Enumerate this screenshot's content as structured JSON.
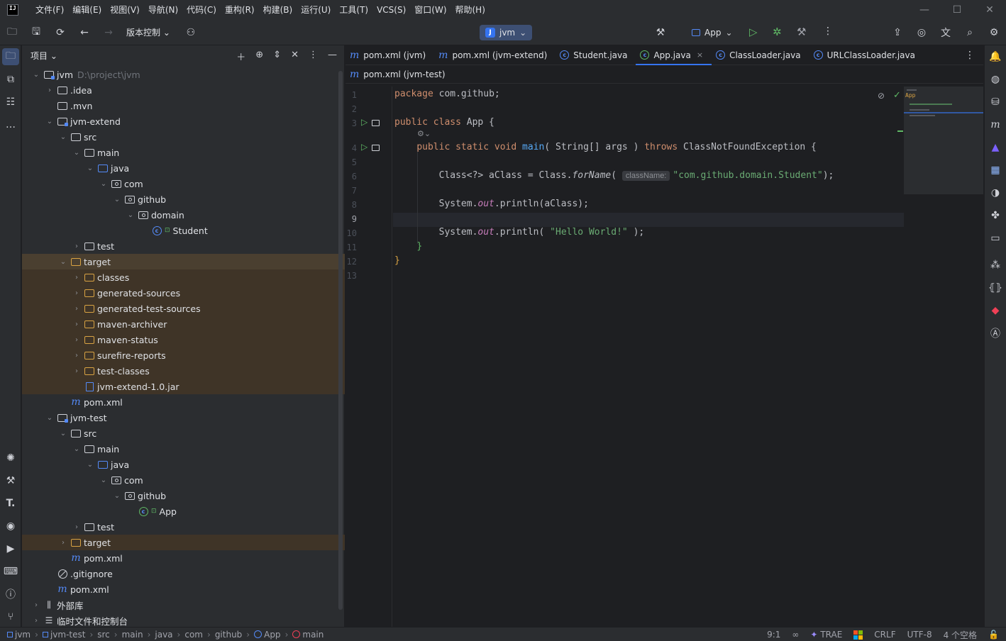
{
  "menu": [
    "文件(F)",
    "编辑(E)",
    "视图(V)",
    "导航(N)",
    "代码(C)",
    "重构(R)",
    "构建(B)",
    "运行(U)",
    "工具(T)",
    "VCS(S)",
    "窗口(W)",
    "帮助(H)"
  ],
  "toolbar": {
    "vcs_label": "版本控制",
    "project_name": "jvm",
    "project_badge": "J",
    "run_config": "App"
  },
  "project_panel": {
    "title": "项目",
    "tree": [
      {
        "label": "jvm",
        "extra": "D:\\project\\jvm",
        "icon": "module",
        "depth": 0,
        "expanded": true
      },
      {
        "label": ".idea",
        "icon": "folder",
        "depth": 1,
        "expanded": false
      },
      {
        "label": ".mvn",
        "icon": "folder",
        "depth": 1,
        "leaf": true
      },
      {
        "label": "jvm-extend",
        "icon": "module",
        "depth": 1,
        "expanded": true
      },
      {
        "label": "src",
        "icon": "folder",
        "depth": 2,
        "expanded": true
      },
      {
        "label": "main",
        "icon": "folder",
        "depth": 3,
        "expanded": true
      },
      {
        "label": "java",
        "icon": "folder-blue",
        "depth": 4,
        "expanded": true
      },
      {
        "label": "com",
        "icon": "package",
        "depth": 5,
        "expanded": true
      },
      {
        "label": "github",
        "icon": "package",
        "depth": 6,
        "expanded": true
      },
      {
        "label": "domain",
        "icon": "package",
        "depth": 7,
        "expanded": true
      },
      {
        "label": "Student",
        "icon": "class",
        "depth": 8,
        "leaf": true
      },
      {
        "label": "test",
        "icon": "folder",
        "depth": 3,
        "expanded": false
      },
      {
        "label": "target",
        "icon": "folder-orange",
        "depth": 2,
        "expanded": true,
        "style": "selected"
      },
      {
        "label": "classes",
        "icon": "folder-orange",
        "depth": 3,
        "expanded": false,
        "style": "excluded"
      },
      {
        "label": "generated-sources",
        "icon": "folder-orange",
        "depth": 3,
        "expanded": false,
        "style": "excluded"
      },
      {
        "label": "generated-test-sources",
        "icon": "folder-orange",
        "depth": 3,
        "expanded": false,
        "style": "excluded"
      },
      {
        "label": "maven-archiver",
        "icon": "folder-orange",
        "depth": 3,
        "expanded": false,
        "style": "excluded"
      },
      {
        "label": "maven-status",
        "icon": "folder-orange",
        "depth": 3,
        "expanded": false,
        "style": "excluded"
      },
      {
        "label": "surefire-reports",
        "icon": "folder-orange",
        "depth": 3,
        "expanded": false,
        "style": "excluded"
      },
      {
        "label": "test-classes",
        "icon": "folder-orange",
        "depth": 3,
        "expanded": false,
        "style": "excluded"
      },
      {
        "label": "jvm-extend-1.0.jar",
        "icon": "jar",
        "depth": 3,
        "leaf": true,
        "style": "excluded"
      },
      {
        "label": "pom.xml",
        "icon": "maven",
        "depth": 2,
        "leaf": true
      },
      {
        "label": "jvm-test",
        "icon": "module",
        "depth": 1,
        "expanded": true
      },
      {
        "label": "src",
        "icon": "folder",
        "depth": 2,
        "expanded": true
      },
      {
        "label": "main",
        "icon": "folder",
        "depth": 3,
        "expanded": true
      },
      {
        "label": "java",
        "icon": "folder-blue",
        "depth": 4,
        "expanded": true
      },
      {
        "label": "com",
        "icon": "package",
        "depth": 5,
        "expanded": true
      },
      {
        "label": "github",
        "icon": "package",
        "depth": 6,
        "expanded": true
      },
      {
        "label": "App",
        "icon": "class-run",
        "depth": 7,
        "leaf": true
      },
      {
        "label": "test",
        "icon": "folder",
        "depth": 3,
        "expanded": false
      },
      {
        "label": "target",
        "icon": "folder-orange",
        "depth": 2,
        "expanded": false,
        "style": "excluded"
      },
      {
        "label": "pom.xml",
        "icon": "maven",
        "depth": 2,
        "leaf": true
      },
      {
        "label": ".gitignore",
        "icon": "gitignore",
        "depth": 1,
        "leaf": true
      },
      {
        "label": "pom.xml",
        "icon": "maven",
        "depth": 1,
        "leaf": true
      },
      {
        "label": "外部库",
        "icon": "library",
        "depth": 0,
        "expanded": false
      },
      {
        "label": "临时文件和控制台",
        "icon": "scratch",
        "depth": 0,
        "expanded": false
      }
    ]
  },
  "editor": {
    "tabs": [
      {
        "label": "pom.xml (jvm)",
        "icon": "maven"
      },
      {
        "label": "pom.xml (jvm-extend)",
        "icon": "maven"
      },
      {
        "label": "Student.java",
        "icon": "class"
      },
      {
        "label": "App.java",
        "icon": "class-run",
        "active": true
      },
      {
        "label": "ClassLoader.java",
        "icon": "class"
      },
      {
        "label": "URLClassLoader.java",
        "icon": "class"
      }
    ],
    "breadcrumb": "pom.xml (jvm-test)",
    "param_hint": "className:",
    "line_numbers": [
      "1",
      "2",
      "3",
      "4",
      "5",
      "6",
      "7",
      "8",
      "9",
      "10",
      "11",
      "12",
      "13"
    ],
    "current_line": "9"
  },
  "statusbar": {
    "crumbs": [
      "jvm",
      "jvm-test",
      "src",
      "main",
      "java",
      "com",
      "github",
      "App",
      "main"
    ],
    "position": "9:1",
    "trae": "TRAE",
    "line_sep": "CRLF",
    "encoding": "UTF-8",
    "indent": "4 个空格"
  },
  "colors": {
    "accent": "#3574f0",
    "keyword": "#cf8e6d",
    "string": "#6aab73",
    "function": "#56a8f5",
    "field": "#c77dbb",
    "excluded_bg": "#3f3427"
  }
}
